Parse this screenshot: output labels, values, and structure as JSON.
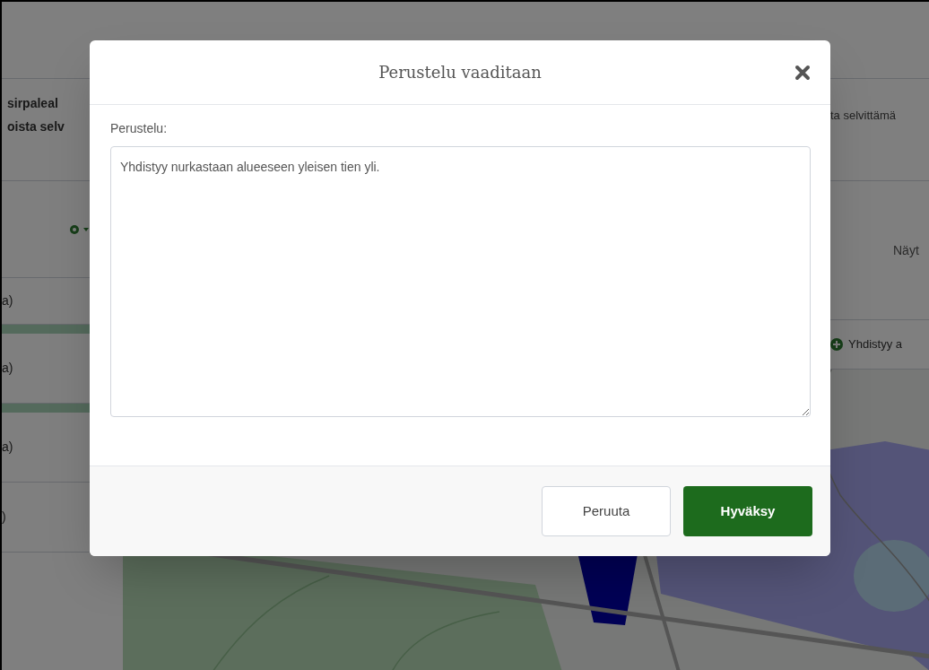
{
  "background": {
    "left_panel": {
      "heading_lines": [
        "sirpaleal",
        "oista selv"
      ],
      "rows": [
        {
          "text": "a)"
        },
        {
          "text": "a)"
        },
        {
          "text": "a)"
        },
        {
          "text": ")"
        }
      ]
    },
    "right_panel": {
      "status_text": "ta selvittämä",
      "label": "Näyt",
      "reason_chip": "Yhdistyy a"
    }
  },
  "dialog": {
    "title": "Perustelu vaaditaan",
    "field_label": "Perustelu:",
    "field_value": "Yhdistyy nurkastaan alueeseen yleisen tien yli.",
    "buttons": [
      {
        "kind": "secondary",
        "label": "Peruuta"
      },
      {
        "kind": "primary",
        "label": "Hyväksy"
      }
    ]
  }
}
